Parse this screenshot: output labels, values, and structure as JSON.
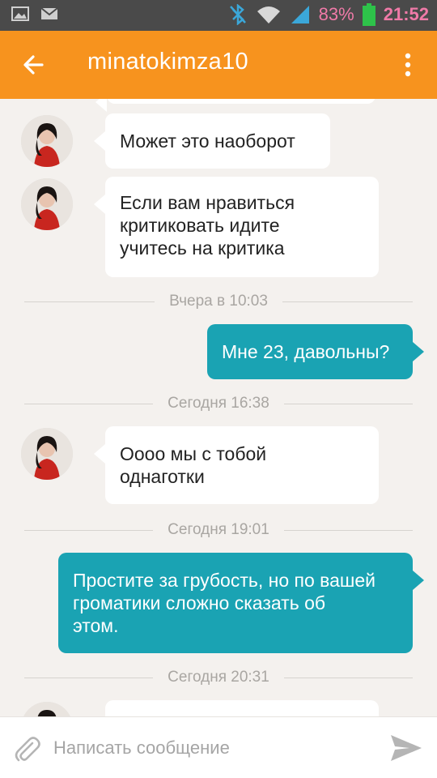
{
  "status_bar": {
    "battery_percent": "83%",
    "time": "21:52",
    "icons": [
      "gallery-icon",
      "mail-icon",
      "bluetooth-off-icon",
      "wifi-icon",
      "signal-icon",
      "battery-icon"
    ]
  },
  "header": {
    "title": "minatokimza10",
    "back_icon": "arrow-left-icon",
    "menu_icon": "more-vertical-icon",
    "color": "#f7931e"
  },
  "messages": [
    {
      "type": "in",
      "text": "Может это наоборот"
    },
    {
      "type": "in",
      "text": "Если вам нравиться\nкритиковать идите\nучитесь на критика"
    },
    {
      "type": "separator",
      "text": "Вчера в 10:03"
    },
    {
      "type": "out",
      "text": "Мне 23, давольны?"
    },
    {
      "type": "separator",
      "text": "Сегодня 16:38"
    },
    {
      "type": "in",
      "text": " Оооо мы с тобой\nоднаготки"
    },
    {
      "type": "separator",
      "text": "Сегодня 19:01"
    },
    {
      "type": "out",
      "text": "Простите за грубость, но по вашей\nгроматики сложно сказать об\nэтом."
    },
    {
      "type": "separator",
      "text": "Сегодня 20:31"
    }
  ],
  "composer": {
    "placeholder": "Написать сообщение",
    "attach_icon": "paperclip-icon",
    "send_icon": "send-icon"
  },
  "colors": {
    "incoming_bubble": "#ffffff",
    "outgoing_bubble": "#1aa3b3",
    "background": "#f4f1ee"
  }
}
